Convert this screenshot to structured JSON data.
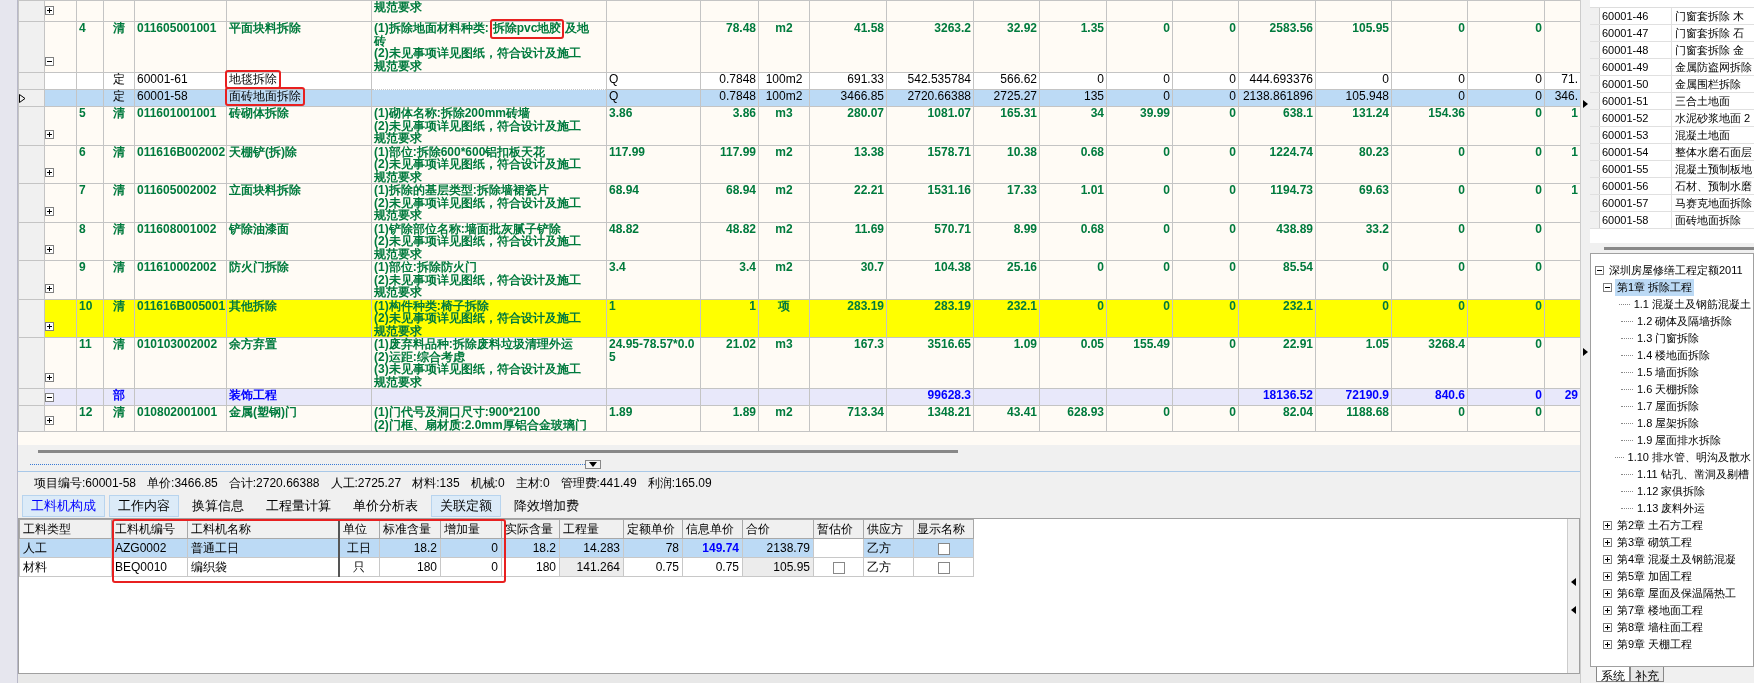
{
  "main_table": {
    "rows": [
      {
        "kind": "item",
        "selected": false,
        "highlighted": false,
        "expanded": false,
        "description": [
          "规范要求"
        ]
      },
      {
        "kind": "item",
        "selected": false,
        "highlighted": false,
        "expanded": true,
        "number": "4",
        "type": "清",
        "code": "011605001001",
        "name": "平面块料拆除",
        "description": [
          [
            {
              "text": "(1)拆除地面材料种类:",
              "marked": false
            },
            {
              "text": "拆除pvc地胶",
              "marked": true
            },
            {
              "text": "及地",
              "marked": false
            }
          ],
          "砖",
          "(2)未见事项详见图纸，符合设计及施工",
          "规范要求"
        ],
        "quantity": "78.48",
        "unit": "m2",
        "values": [
          "41.58",
          "3263.2",
          "32.92",
          "1.35",
          "0",
          "0",
          "2583.56",
          "105.95",
          "0",
          "0"
        ]
      },
      {
        "kind": "quota",
        "selected": false,
        "highlighted": false,
        "name_marked": true,
        "type": "定",
        "code": "60001-61",
        "name": "地毯拆除",
        "expression": "Q",
        "quantity": "0.7848",
        "unit": "100m2",
        "values": [
          "691.33",
          "542.535784",
          "566.62",
          "0",
          "0",
          "0",
          "444.693376",
          "0",
          "0",
          "0"
        ],
        "edge": "71."
      },
      {
        "kind": "quota",
        "selected": true,
        "highlighted": false,
        "name_marked": true,
        "type": "定",
        "code": "60001-58",
        "name": "面砖地面拆除",
        "expression": "Q",
        "quantity": "0.7848",
        "unit": "100m2",
        "values": [
          "3466.85",
          "2720.66388",
          "2725.27",
          "135",
          "0",
          "0",
          "2138.861896",
          "105.948",
          "0",
          "0"
        ],
        "edge": "346."
      },
      {
        "kind": "item",
        "selected": false,
        "highlighted": false,
        "expanded": false,
        "number": "5",
        "type": "清",
        "code": "011601001001",
        "name": "砖砌体拆除",
        "description": [
          "(1)砌体名称:拆除200mm砖墙",
          "(2)未见事项详见图纸，符合设计及施工",
          "规范要求"
        ],
        "expression": "3.86",
        "quantity": "3.86",
        "unit": "m3",
        "values": [
          "280.07",
          "1081.07",
          "165.31",
          "34",
          "39.99",
          "0",
          "638.1",
          "131.24",
          "154.36",
          "0"
        ],
        "edge": "1"
      },
      {
        "kind": "item",
        "selected": false,
        "highlighted": false,
        "expanded": false,
        "number": "6",
        "type": "清",
        "code": "011616B002002",
        "name": "天棚铲(拆)除",
        "description": [
          "(1)部位:拆除600*600铝扣板天花",
          "(2)未见事项详见图纸，符合设计及施工",
          "规范要求"
        ],
        "expression": "117.99",
        "quantity": "117.99",
        "unit": "m2",
        "values": [
          "13.38",
          "1578.71",
          "10.38",
          "0.68",
          "0",
          "0",
          "1224.74",
          "80.23",
          "0",
          "0"
        ],
        "edge": "1"
      },
      {
        "kind": "item",
        "selected": false,
        "highlighted": false,
        "expanded": false,
        "number": "7",
        "type": "清",
        "code": "011605002002",
        "name": "立面块料拆除",
        "description": [
          "(1)拆除的基层类型:拆除墙裙瓷片",
          "(2)未见事项详见图纸，符合设计及施工",
          "规范要求"
        ],
        "expression": "68.94",
        "quantity": "68.94",
        "unit": "m2",
        "values": [
          "22.21",
          "1531.16",
          "17.33",
          "1.01",
          "0",
          "0",
          "1194.73",
          "69.63",
          "0",
          "0"
        ],
        "edge": "1"
      },
      {
        "kind": "item",
        "selected": false,
        "highlighted": false,
        "expanded": false,
        "number": "8",
        "type": "清",
        "code": "011608001002",
        "name": "铲除油漆面",
        "description": [
          "(1)铲除部位名称:墙面批灰腻子铲除",
          "(2)未见事项详见图纸，符合设计及施工",
          "规范要求"
        ],
        "expression": "48.82",
        "quantity": "48.82",
        "unit": "m2",
        "values": [
          "11.69",
          "570.71",
          "8.99",
          "0.68",
          "0",
          "0",
          "438.89",
          "33.2",
          "0",
          "0"
        ]
      },
      {
        "kind": "item",
        "selected": false,
        "highlighted": false,
        "expanded": false,
        "number": "9",
        "type": "清",
        "code": "011610002002",
        "name": "防火门拆除",
        "description": [
          "(1)部位:拆除防火门",
          "(2)未见事项详见图纸，符合设计及施工",
          "规范要求"
        ],
        "expression": "3.4",
        "quantity": "3.4",
        "unit": "m2",
        "values": [
          "30.7",
          "104.38",
          "25.16",
          "0",
          "0",
          "0",
          "85.54",
          "0",
          "0",
          "0"
        ]
      },
      {
        "kind": "item",
        "selected": false,
        "highlighted": true,
        "expanded": false,
        "number": "10",
        "type": "清",
        "code": "011616B005001",
        "name": "其他拆除",
        "description": [
          "(1)构件种类:椅子拆除",
          "(2)未见事项详见图纸，符合设计及施工",
          "规范要求"
        ],
        "expression": "1",
        "quantity": "1",
        "unit": "项",
        "values": [
          "283.19",
          "283.19",
          "232.1",
          "0",
          "0",
          "0",
          "232.1",
          "0",
          "0",
          "0"
        ]
      },
      {
        "kind": "item",
        "selected": false,
        "highlighted": false,
        "expanded": false,
        "number": "11",
        "type": "清",
        "code": "010103002002",
        "name": "余方弃置",
        "description": [
          "(1)废弃料品种:拆除废料垃圾清理外运",
          "(2)运距:综合考虑",
          "(3)未见事项详见图纸，符合设计及施工",
          "规范要求"
        ],
        "expression": "24.95-78.57*0.05",
        "quantity": "21.02",
        "unit": "m3",
        "values": [
          "167.3",
          "3516.65",
          "1.09",
          "0.05",
          "155.49",
          "0",
          "22.91",
          "1.05",
          "3268.4",
          "0"
        ]
      },
      {
        "kind": "section",
        "selected": false,
        "highlighted": false,
        "expanded": true,
        "type": "部",
        "name": "装饰工程",
        "value_2": "99628.3",
        "value_7": "18136.52",
        "value_8": "72190.9",
        "value_9": "840.6",
        "value_10": "0",
        "edge": "29"
      },
      {
        "kind": "item",
        "selected": false,
        "highlighted": false,
        "expanded": false,
        "number": "12",
        "type": "清",
        "code": "010802001001",
        "name": "金属(塑钢)门",
        "description": [
          "(1)门代号及洞口尺寸:900*2100",
          "(2)门框、扇材质:2.0mm厚铝合金玻璃门"
        ],
        "expression": "1.89",
        "quantity": "1.89",
        "unit": "m2",
        "values": [
          "713.34",
          "1348.21",
          "43.41",
          "628.93",
          "0",
          "0",
          "82.04",
          "1188.68",
          "0",
          "0"
        ]
      }
    ]
  },
  "summary": [
    "项目编号:60001-58",
    "单价:3466.85",
    "合计:2720.66388",
    "人工:2725.27",
    "材料:135",
    "机械:0",
    "主材:0",
    "管理费:441.49",
    "利润:165.09"
  ],
  "detail_tabs": [
    {
      "label": "工料机构成",
      "selected": true,
      "shaded": true
    },
    {
      "label": "工作内容",
      "selected": false,
      "shaded": true
    },
    {
      "label": "换算信息",
      "selected": false,
      "shaded": false
    },
    {
      "label": "工程量计算",
      "selected": false,
      "shaded": false
    },
    {
      "label": "单价分析表",
      "selected": false,
      "shaded": false
    },
    {
      "label": "关联定额",
      "selected": false,
      "shaded": true
    },
    {
      "label": "降效增加费",
      "selected": false,
      "shaded": false
    }
  ],
  "resource_table": {
    "marked": true,
    "columns": [
      "工料类型",
      "工料机编号",
      "工料机名称",
      "单位",
      "标准含量",
      "增加量",
      "实际含量",
      "工程量",
      "定额单价",
      "信息单价",
      "合价",
      "暂估价",
      "供应方",
      "显示名称"
    ],
    "rows": [
      {
        "selected": true,
        "price_changed": true,
        "cells": [
          "人工",
          "AZG0002",
          "普通工日",
          "工日",
          "18.2",
          "0",
          "18.2",
          "14.283",
          "78",
          "149.74",
          "2138.79"
        ],
        "supplier": "乙方",
        "show_name": false
      },
      {
        "selected": false,
        "price_changed": false,
        "cells": [
          "材料",
          "BEQ0010",
          "编织袋",
          "只",
          "180",
          "0",
          "180",
          "141.264",
          "0.75",
          "0.75",
          "105.95"
        ],
        "provisional": false,
        "supplier": "乙方",
        "show_name": false
      }
    ]
  },
  "quota_list": {
    "rows": [
      {
        "code": "60001-46",
        "name": "门窗套拆除 木"
      },
      {
        "code": "60001-47",
        "name": "门窗套拆除 石"
      },
      {
        "code": "60001-48",
        "name": "门窗套拆除 金"
      },
      {
        "code": "60001-49",
        "name": "金属防盗网拆除"
      },
      {
        "code": "60001-50",
        "name": "金属围栏拆除"
      },
      {
        "code": "60001-51",
        "name": "三合土地面"
      },
      {
        "code": "60001-52",
        "name": "水泥砂浆地面 2"
      },
      {
        "code": "60001-53",
        "name": "混凝土地面"
      },
      {
        "code": "60001-54",
        "name": "整体水磨石面层"
      },
      {
        "code": "60001-55",
        "name": "混凝土预制板地"
      },
      {
        "code": "60001-56",
        "name": "石材、预制水磨"
      },
      {
        "code": "60001-57",
        "name": "马赛克地面拆除"
      },
      {
        "code": "60001-58",
        "name": "面砖地面拆除"
      }
    ]
  },
  "chapter_tree": [
    {
      "label": "深圳房屋修缮工程定额2011",
      "selected": false,
      "expanded": true,
      "children": [
        {
          "label": "第1章 拆除工程",
          "selected": true,
          "expanded": true,
          "children": [
            {
              "label": "1.1 混凝土及钢筋混凝土",
              "selected": false
            },
            {
              "label": "1.2 砌体及隔墙拆除",
              "selected": false
            },
            {
              "label": "1.3 门窗拆除",
              "selected": false
            },
            {
              "label": "1.4 楼地面拆除",
              "selected": false
            },
            {
              "label": "1.5 墙面拆除",
              "selected": false
            },
            {
              "label": "1.6 天棚拆除",
              "selected": false
            },
            {
              "label": "1.7 屋面拆除",
              "selected": false
            },
            {
              "label": "1.8 屋架拆除",
              "selected": false
            },
            {
              "label": "1.9 屋面排水拆除",
              "selected": false
            },
            {
              "label": "1.10 排水管、明沟及散水",
              "selected": false
            },
            {
              "label": "1.11 钻孔、凿洞及剔槽",
              "selected": false
            },
            {
              "label": "1.12 家俱拆除",
              "selected": false
            },
            {
              "label": "1.13 废料外运",
              "selected": false
            }
          ]
        },
        {
          "label": "第2章 土石方工程",
          "selected": false,
          "expanded": false
        },
        {
          "label": "第3章 砌筑工程",
          "selected": false,
          "expanded": false
        },
        {
          "label": "第4章 混凝土及钢筋混凝",
          "selected": false,
          "expanded": false
        },
        {
          "label": "第5章 加固工程",
          "selected": false,
          "expanded": false
        },
        {
          "label": "第6章 屋面及保温隔热工",
          "selected": false,
          "expanded": false
        },
        {
          "label": "第7章 楼地面工程",
          "selected": false,
          "expanded": false
        },
        {
          "label": "第8章 墙柱面工程",
          "selected": false,
          "expanded": false
        },
        {
          "label": "第9章 天棚工程",
          "selected": false,
          "expanded": false
        }
      ]
    }
  ],
  "library_tabs": [
    {
      "label": "系统",
      "selected": true
    },
    {
      "label": "补充",
      "selected": false
    }
  ]
}
